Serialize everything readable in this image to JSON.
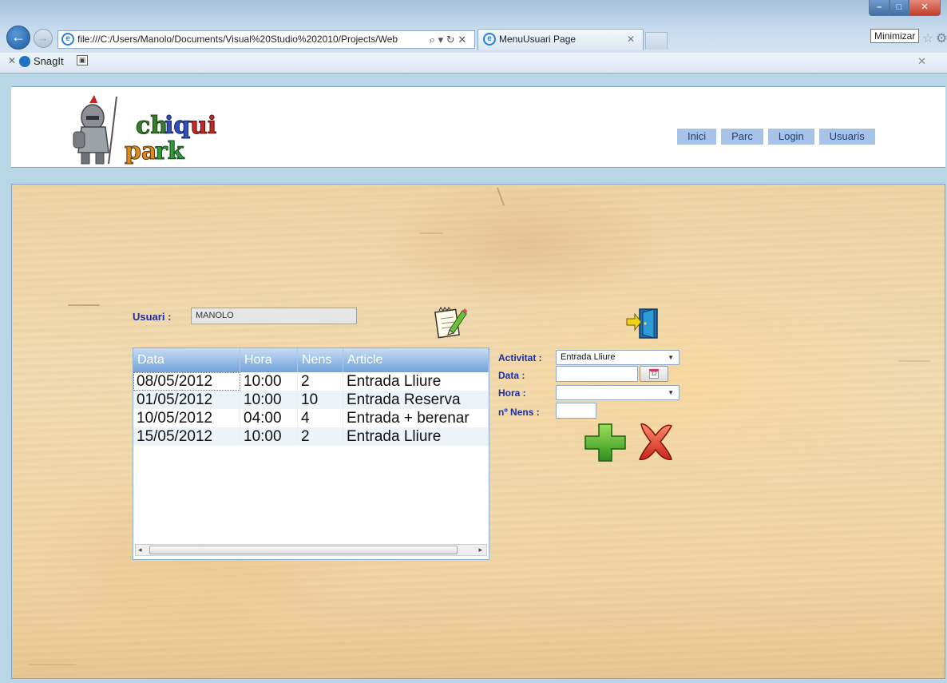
{
  "browser": {
    "address": "file:///C:/Users/Manolo/Documents/Visual%20Studio%202010/Projects/Web",
    "address_actions": "⌕ ▾ ↻ ✕",
    "tab_title": "MenuUsuari Page",
    "tooltip": "Minimizar",
    "toolbar_item": "SnagIt"
  },
  "header": {
    "logo_text": "chiqui park",
    "menu": [
      "Inici",
      "Parc",
      "Login",
      "Usuaris"
    ]
  },
  "user": {
    "label": "Usuari :",
    "value": "MANOLO"
  },
  "grid": {
    "columns": [
      "Data",
      "Hora",
      "Nens",
      "Article"
    ],
    "rows": [
      [
        "08/05/2012",
        "10:00",
        "2",
        "Entrada Lliure"
      ],
      [
        "01/05/2012",
        "10:00",
        "10",
        "Entrada Reserva"
      ],
      [
        "10/05/2012",
        "04:00",
        "4",
        "Entrada + berenar"
      ],
      [
        "15/05/2012",
        "10:00",
        "2",
        "Entrada Lliure"
      ]
    ]
  },
  "form": {
    "activitat_label": "Activitat :",
    "activitat_value": "Entrada Lliure",
    "data_label": "Data :",
    "data_value": "",
    "hora_label": "Hora :",
    "hora_value": "",
    "nens_label": "nº Nens :",
    "nens_value": ""
  },
  "icons": {
    "edit": "notepad-pencil-icon",
    "exit": "exit-door-icon",
    "add": "green-plus-icon",
    "cancel": "red-x-icon",
    "calendar": "calendar-icon"
  },
  "colors": {
    "label_blue": "#1c2ea0",
    "menu_bg": "#a7c4e8",
    "grid_header": "#6fa2dc",
    "wood": "#f1d6a6"
  }
}
